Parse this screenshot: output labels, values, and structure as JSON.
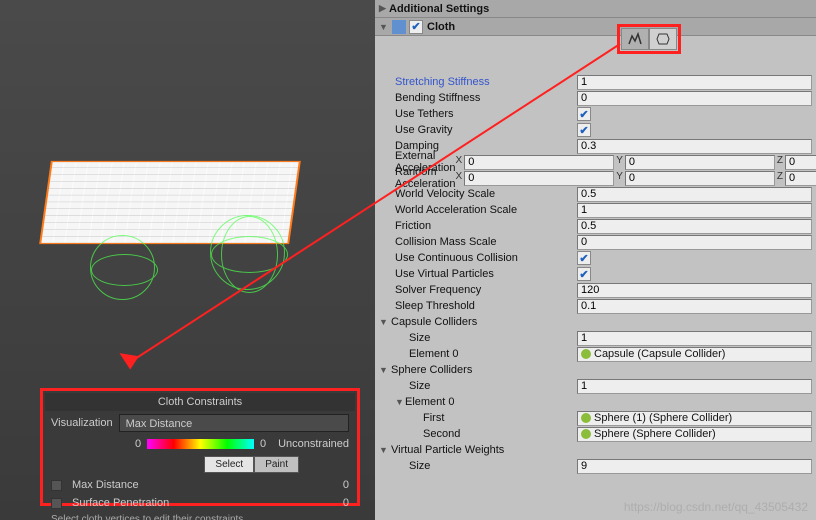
{
  "scene": {
    "constraints": {
      "title": "Cloth Constraints",
      "viz_label": "Visualization",
      "viz_value": "Max Distance",
      "grad_min": "0",
      "grad_max": "0",
      "unconstrained": "Unconstrained",
      "select": "Select",
      "paint": "Paint",
      "max_dist": "Max Distance",
      "max_dist_val": "0",
      "surf_pen": "Surface Penetration",
      "surf_pen_val": "0",
      "footer": "Select cloth vertices to edit their constraints."
    }
  },
  "inspector": {
    "additional": "Additional Settings",
    "component": "Cloth",
    "props": {
      "stretching": {
        "label": "Stretching Stiffness",
        "value": "1"
      },
      "bending": {
        "label": "Bending Stiffness",
        "value": "0"
      },
      "tethers": {
        "label": "Use Tethers"
      },
      "gravity": {
        "label": "Use Gravity"
      },
      "damping": {
        "label": "Damping",
        "value": "0.3"
      },
      "ext_accel": {
        "label": "External Acceleration",
        "x": "0",
        "y": "0",
        "z": "0"
      },
      "rand_accel": {
        "label": "Random Acceleration",
        "x": "0",
        "y": "0",
        "z": "0"
      },
      "world_vel": {
        "label": "World Velocity Scale",
        "value": "0.5"
      },
      "world_accel": {
        "label": "World Acceleration Scale",
        "value": "1"
      },
      "friction": {
        "label": "Friction",
        "value": "0.5"
      },
      "coll_mass": {
        "label": "Collision Mass Scale",
        "value": "0"
      },
      "cont_coll": {
        "label": "Use Continuous Collision"
      },
      "virt_part": {
        "label": "Use Virtual Particles"
      },
      "solver": {
        "label": "Solver Frequency",
        "value": "120"
      },
      "sleep": {
        "label": "Sleep Threshold",
        "value": "0.1"
      },
      "capsule": {
        "label": "Capsule Colliders",
        "size_label": "Size",
        "size": "1",
        "el0_label": "Element 0",
        "el0": "Capsule (Capsule Collider)"
      },
      "sphere": {
        "label": "Sphere Colliders",
        "size_label": "Size",
        "size": "1",
        "el0_label": "Element 0",
        "first_label": "First",
        "first": "Sphere (1) (Sphere Collider)",
        "second_label": "Second",
        "second": "Sphere (Sphere Collider)"
      },
      "vpw": {
        "label": "Virtual Particle Weights",
        "size_label": "Size",
        "size": "9"
      }
    }
  },
  "watermark": "https://blog.csdn.net/qq_43505432"
}
